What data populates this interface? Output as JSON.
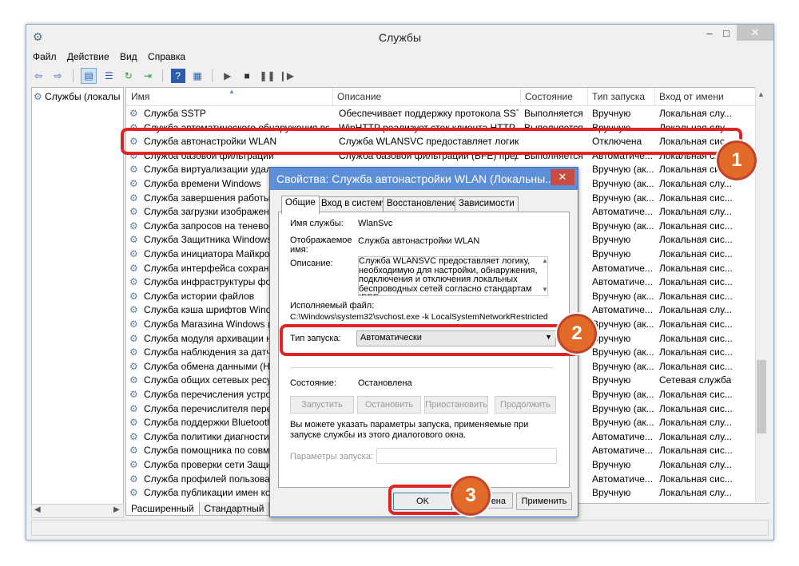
{
  "window": {
    "title": "Службы",
    "controls": {
      "minimize": "–",
      "maximize": "□",
      "close": "✕"
    }
  },
  "menu": [
    "Файл",
    "Действие",
    "Вид",
    "Справка"
  ],
  "toolbar_icons": [
    "back-icon",
    "forward-icon",
    "console-tree-icon",
    "list-icon",
    "refresh-icon",
    "export-icon",
    "help-icon",
    "properties-icon",
    "play-icon",
    "stop-icon",
    "pause-icon",
    "restart-icon"
  ],
  "left_pane": {
    "item": "Службы (локалы"
  },
  "columns": [
    "Имя",
    "Описание",
    "Состояние",
    "Тип запуска",
    "Вход от имени"
  ],
  "rows": [
    {
      "name": "Служба SSTP",
      "desc": "Обеспечивает поддержку протокола SSTP...",
      "state": "Выполняется",
      "startup": "Вручную",
      "logon": "Локальная слу..."
    },
    {
      "name": "Служба автоматического обнаружения веб-...",
      "desc": "WinHTTP реализует стек клиента HTTP...",
      "state": "Выполняется",
      "startup": "Вручную",
      "logon": "Локальная слу..."
    },
    {
      "name": "Служба автонастройки WLAN",
      "desc": "Служба WLANSVC предоставляет логику, ...",
      "state": "",
      "startup": "Отключена",
      "logon": "Локальная сис..."
    },
    {
      "name": "Служба базовой фильтрации",
      "desc": "Служба базовой фильтрации (BFE) представ...",
      "state": "Выполняется",
      "startup": "Автоматиче...",
      "logon": "Локальная слу..."
    },
    {
      "name": "Служба виртуализации удален",
      "desc": "",
      "state": "",
      "startup": "Вручную (ак...",
      "logon": "Локальная сис..."
    },
    {
      "name": "Служба времени Windows",
      "desc": "",
      "state": "",
      "startup": "Вручную (ак...",
      "logon": "Локальная слу..."
    },
    {
      "name": "Служба завершения работы в",
      "desc": "",
      "state": "",
      "startup": "Вручную (ак...",
      "logon": "Локальная сис..."
    },
    {
      "name": "Служба загрузки изображений",
      "desc": "",
      "state": "",
      "startup": "Автоматиче...",
      "logon": "Локальная слу..."
    },
    {
      "name": "Служба запросов на теневое к",
      "desc": "",
      "state": "",
      "startup": "Вручную (ак...",
      "logon": "Локальная сис..."
    },
    {
      "name": "Служба Защитника Windows",
      "desc": "",
      "state": "",
      "startup": "Вручную",
      "logon": "Локальная сис..."
    },
    {
      "name": "Служба инициатора Майкрософ",
      "desc": "",
      "state": "",
      "startup": "Вручную",
      "logon": "Локальная сис..."
    },
    {
      "name": "Служба интерфейса сохранени",
      "desc": "",
      "state": "",
      "startup": "Автоматиче...",
      "logon": "Локальная сис..."
    },
    {
      "name": "Служба инфраструктуры фоно",
      "desc": "",
      "state": "",
      "startup": "Автоматиче...",
      "logon": "Локальная сис..."
    },
    {
      "name": "Служба истории файлов",
      "desc": "",
      "state": "",
      "startup": "Вручную (ак...",
      "logon": "Локальная сис..."
    },
    {
      "name": "Служба кэша шрифтов Window",
      "desc": "",
      "state": "",
      "startup": "Автоматиче...",
      "logon": "Локальная слу..."
    },
    {
      "name": "Служба Магазина Windows (WS",
      "desc": "",
      "state": "",
      "startup": "Вручную (ак...",
      "logon": "Локальная сис..."
    },
    {
      "name": "Служба модуля архивации на у",
      "desc": "",
      "state": "",
      "startup": "Вручную",
      "logon": "Локальная сис..."
    },
    {
      "name": "Служба наблюдения за датчика",
      "desc": "",
      "state": "",
      "startup": "Вручную (ак...",
      "logon": "Локальная сис..."
    },
    {
      "name": "Служба обмена данными (Hyp",
      "desc": "",
      "state": "",
      "startup": "Вручную (ак...",
      "logon": "Локальная сис..."
    },
    {
      "name": "Служба общих сетевых ресурс",
      "desc": "",
      "state": "",
      "startup": "Вручную",
      "logon": "Сетевая служба"
    },
    {
      "name": "Служба перечисления устройс",
      "desc": "",
      "state": "",
      "startup": "Вручную (ак...",
      "logon": "Локальная сис..."
    },
    {
      "name": "Служба перечислителя перено",
      "desc": "",
      "state": "",
      "startup": "Вручную (ак...",
      "logon": "Локальная сис..."
    },
    {
      "name": "Служба поддержки Bluetooth",
      "desc": "",
      "state": "",
      "startup": "Вручную (ак...",
      "logon": "Локальная слу..."
    },
    {
      "name": "Служба политики диагностиче",
      "desc": "",
      "state": "",
      "startup": "Автоматиче...",
      "logon": "Локальная слу..."
    },
    {
      "name": "Служба помощника по совмес",
      "desc": "",
      "state": "",
      "startup": "Автоматиче...",
      "logon": "Локальная сис..."
    },
    {
      "name": "Служба проверки сети Защитн",
      "desc": "",
      "state": "",
      "startup": "Вручную",
      "logon": "Локальная слу..."
    },
    {
      "name": "Служба профилей пользовате",
      "desc": "",
      "state": "",
      "startup": "Автоматиче...",
      "logon": "Локальная сис..."
    },
    {
      "name": "Служба публикации имен ком",
      "desc": "",
      "state": "",
      "startup": "Вручную",
      "logon": "Локальная слу..."
    }
  ],
  "bottom_tabs": [
    "Расширенный",
    "Стандартный"
  ],
  "dialog": {
    "title": "Свойства: Служба автонастройки WLAN (Локальны...",
    "close": "✕",
    "tabs": [
      "Общие",
      "Вход в систему",
      "Восстановление",
      "Зависимости"
    ],
    "service_name_label": "Имя службы:",
    "service_name": "WlanSvc",
    "display_name_label": "Отображаемое имя:",
    "display_name": "Служба автонастройки WLAN",
    "description_label": "Описание:",
    "description": "Служба WLANSVC предоставляет логику, необходимую для настройки, обнаружения, подключения и отключения локальных беспроводных сетей согласно стандартам IEEE",
    "exe_label": "Исполняемый файл:",
    "exe_path": "C:\\Windows\\system32\\svchost.exe -k LocalSystemNetworkRestricted",
    "startup_label": "Тип запуска:",
    "startup_value": "Автоматически",
    "state_label": "Состояние:",
    "state_value": "Остановлена",
    "btn_start": "Запустить",
    "btn_stop": "Остановить",
    "btn_pause": "Приостановить",
    "btn_resume": "Продолжить",
    "hint": "Вы можете указать параметры запуска, применяемые при запуске службы из этого диалогового окна.",
    "params_label": "Параметры запуска:",
    "btn_ok": "OK",
    "btn_cancel_partial": "ена",
    "btn_apply": "Применить"
  },
  "markers": [
    "1",
    "2",
    "3"
  ],
  "colors": {
    "highlight": "#e02424",
    "marker": "#e36b2a",
    "dialog_title": "#5d8fd8"
  }
}
